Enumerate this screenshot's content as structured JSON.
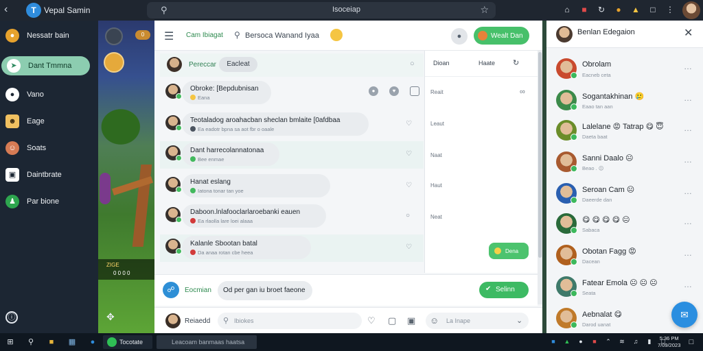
{
  "topbar": {
    "app_title": "Vepal Samin",
    "url": "Isoceiap",
    "icons": [
      "home-icon",
      "apps-icon",
      "refresh-icon",
      "extension-icon",
      "notification-icon",
      "window-icon",
      "menu-icon"
    ]
  },
  "sidebar": {
    "items": [
      {
        "label": "Nessatr bain",
        "icon": "profile-icon",
        "color": "#e6a22d"
      },
      {
        "label": "Dant Tmmna",
        "icon": "compass-icon",
        "color": "#ffffff",
        "active": true
      },
      {
        "label": "Vano",
        "icon": "circle-icon",
        "color": "#ffffff"
      },
      {
        "label": "Eage",
        "icon": "people-icon",
        "color": "#f0c060"
      },
      {
        "label": "Soats",
        "icon": "person-icon",
        "color": "#d67b54"
      },
      {
        "label": "Daintbrate",
        "icon": "badge-icon",
        "color": "#ffffff"
      },
      {
        "label": "Par bione",
        "icon": "group-icon",
        "color": "#2ea64f"
      }
    ]
  },
  "game": {
    "badge": "0",
    "hud_label": "ZIGE",
    "hud_value": "0 0 0 0"
  },
  "chat": {
    "title": "Cam Ibiagat",
    "search_text": "Bersoca Wanand Iyaa",
    "status_button": "Wealt Dan",
    "thread": {
      "name": "Pereccar",
      "pill": "Eacleat"
    },
    "messages": [
      {
        "title": "Obroke: [Bepdubnisan",
        "sub": "Eana",
        "mark_color": "#f5c542"
      },
      {
        "title": "Teotaladog aroahacban sheclan bmlaite [0afdbaa",
        "sub": "Ea eadotr bpna sa aot fbr o oaale",
        "mark_color": "#4b5460"
      },
      {
        "title": "Dant harrecolannatonaa",
        "sub": "Bee enmae",
        "mark_color": "#43b95e"
      },
      {
        "title": "Hanat eslang",
        "sub": "Iatona tonar tan yoe",
        "mark_color": "#43b95e"
      },
      {
        "title": "Daboon.lnlafooclarlaroebanki eauen",
        "sub": "Ea rlaolla lare loei alaaa",
        "mark_color": "#d23a3a"
      },
      {
        "title": "Kalanle Sbootan batal",
        "sub": "Da anaa rotan cbe heea",
        "mark_color": "#d23a3a"
      }
    ],
    "right_col": {
      "tab1": "Dioan",
      "tab2": "Haate",
      "items": [
        "Reait",
        "Leaut",
        "Naat",
        "Haut",
        "Neat"
      ],
      "button": "Dena"
    },
    "compose": {
      "name": "Eocmian",
      "text": "Od per gan iu broet faeone",
      "send": "Selinn"
    },
    "footer": {
      "name": "Reiaedd",
      "placeholder": "Ibiokes",
      "placeholder2": "La Inape"
    }
  },
  "contacts": {
    "title": "Benlan Edegaion",
    "rows": [
      {
        "name": "Obrolam",
        "status": "Eacneb ceta",
        "color": "#c94a2e"
      },
      {
        "name": "Sogantakhinan 🥲",
        "status": "Eaao tan aan",
        "color": "#3c8a4a"
      },
      {
        "name": "Lalelane 😡 Tatrap 😋 😇",
        "status": "Daeta baat",
        "color": "#6b8d2a"
      },
      {
        "name": "Sanni Daalo 😐",
        "status": "Beao . 😐",
        "color": "#a85a30"
      },
      {
        "name": "Seroan Cam 😐",
        "status": "Daeerde dan",
        "color": "#2a5fb0"
      },
      {
        "name": "😋 😋 😋 😋 😐",
        "status": "Sabaca",
        "color": "#2a6a3a"
      },
      {
        "name": "Obotan Fagg 😡",
        "status": "Dacean",
        "color": "#b0601e"
      },
      {
        "name": "Fatear Emola 😐 😐 😐",
        "status": "Seata",
        "color": "#3f7a6a"
      },
      {
        "name": "Aebnalat 😋",
        "status": "Darod uanat",
        "color": "#c07a2a"
      }
    ]
  },
  "taskbar": {
    "app_label": "Tocotate",
    "window_label": "Leacoam banmaas haatsa",
    "clock_time": "5:36 PM",
    "clock_date": "7/09/2023"
  }
}
